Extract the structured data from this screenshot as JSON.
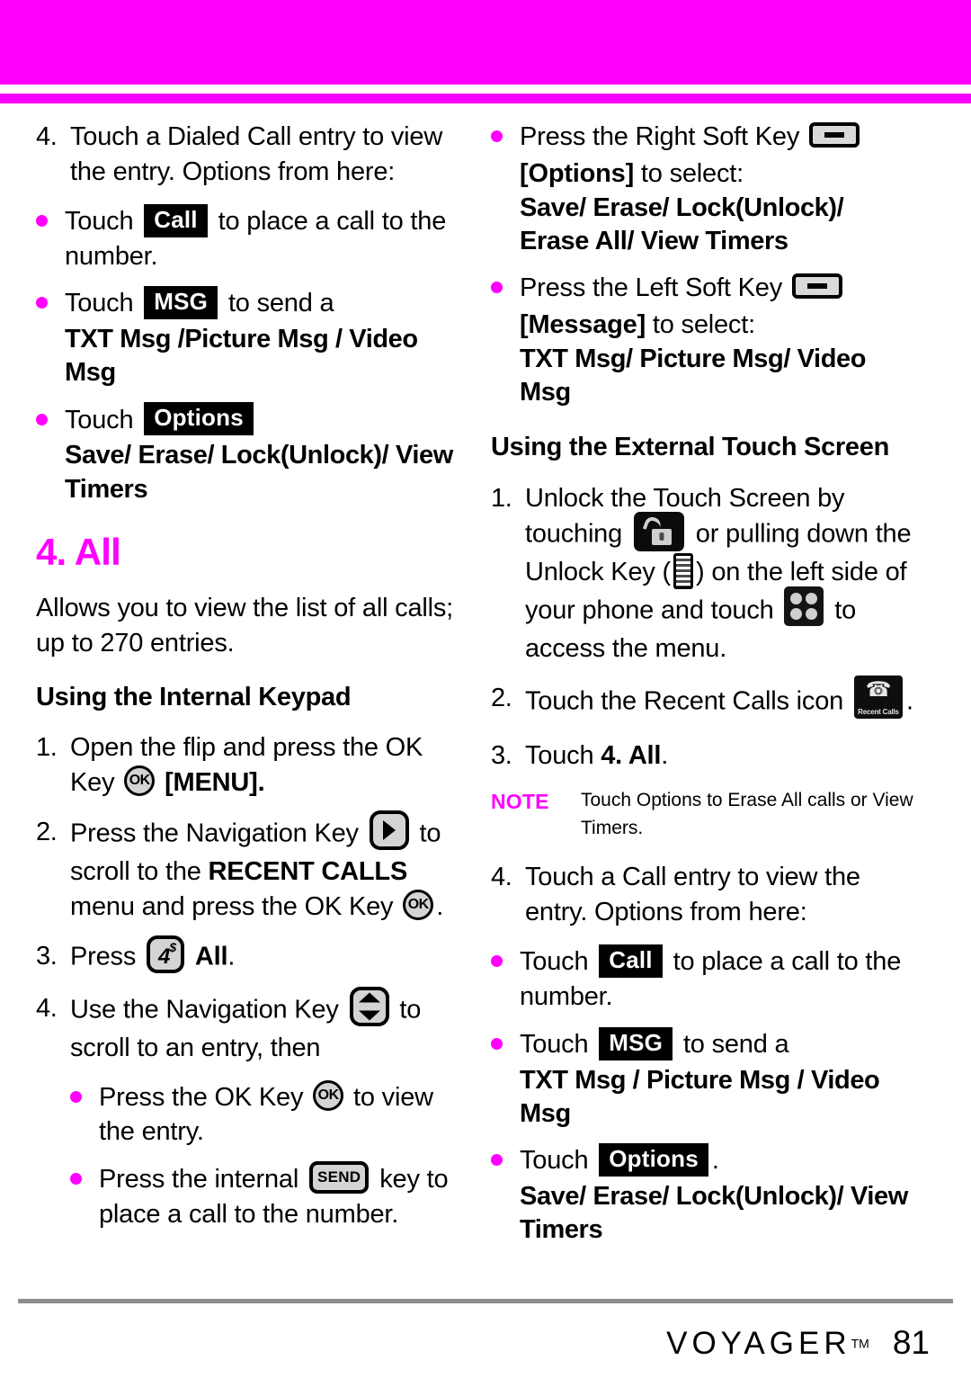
{
  "theme": {
    "accent": "#ff00ff",
    "text": "#000000",
    "background": "#ffffff",
    "rule": "#8c8c8c",
    "chip_bg": "#000000",
    "chip_fg": "#ffffff",
    "key_face": "#d4d4d4"
  },
  "banner": {
    "label": "top-magenta-banner"
  },
  "left_column": {
    "step4": {
      "number": "4.",
      "text": "Touch a Dialed Call entry to view the entry. Options from here:"
    },
    "bullet_call": {
      "pre": "Touch",
      "chip": "Call",
      "post": "to place a call to the number."
    },
    "bullet_msg": {
      "pre": "Touch",
      "chip": "MSG",
      "post": "to send a",
      "options": "TXT Msg /Picture Msg / Video Msg"
    },
    "bullet_options": {
      "pre": "Touch",
      "chip": "Options",
      "options": "Save/ Erase/ Lock(Unlock)/ View Timers"
    },
    "heading": "4. All",
    "intro": "Allows you to view the list of all calls; up to 270 entries.",
    "section_heading": "Using the Internal Keypad",
    "steps": [
      {
        "number": "1.",
        "pre": "Open the flip and press the OK Key",
        "key": "OK",
        "post": "[MENU]."
      },
      {
        "number": "2.",
        "pre": "Press the Navigation Key",
        "key": "nav-right",
        "mid": "to scroll to the",
        "bold": "RECENT CALLS",
        "post": "menu and press the OK Key",
        "key2": "OK",
        "tail": "."
      },
      {
        "number": "3.",
        "pre": "Press",
        "key": "4",
        "key_sub": "$",
        "bold": "All",
        "post": "."
      },
      {
        "number": "4.",
        "pre": "Use the Navigation Key",
        "key": "nav-up-down",
        "post": "to scroll to an entry, then"
      }
    ],
    "sub_bullets": [
      {
        "pre": "Press the OK Key",
        "key": "OK",
        "post": "to view the entry."
      },
      {
        "pre": "Press the internal",
        "key": "SEND",
        "post": "key to place a call to the number."
      }
    ]
  },
  "right_column": {
    "bullet_right_soft": {
      "pre": "Press the Right Soft Key",
      "key": "soft-key",
      "bracket": "[Options]",
      "mid": "to select:",
      "options": "Save/ Erase/ Lock(Unlock)/ Erase All/ View Timers"
    },
    "bullet_left_soft": {
      "pre": "Press the Left Soft Key",
      "key": "soft-key",
      "bracket": "[Message]",
      "mid": "to select:",
      "options": "TXT Msg/ Picture Msg/ Video Msg"
    },
    "section_heading": "Using the External Touch Screen",
    "step1": {
      "number": "1.",
      "p1": "Unlock the Touch Screen by touching",
      "icon1": "unlock-tile",
      "p2": "or pulling down the Unlock Key (",
      "icon2": "unlock-bar",
      "p3": ") on the left side of your phone and touch",
      "icon3": "menu-tile",
      "p4": "to access the menu."
    },
    "step2": {
      "number": "2.",
      "pre": "Touch the Recent Calls icon",
      "icon": "recent-calls-tile",
      "icon_caption": "Recent Calls",
      "post": "."
    },
    "step3": {
      "number": "3.",
      "pre": "Touch",
      "bold": "4. All",
      "post": "."
    },
    "note": {
      "tag": "NOTE",
      "text": "Touch Options to Erase All calls or View Timers."
    },
    "step4": {
      "number": "4.",
      "text": "Touch a Call entry to view the entry. Options from here:"
    },
    "bullet_call": {
      "pre": "Touch",
      "chip": "Call",
      "post": "to place a call to the number."
    },
    "bullet_msg": {
      "pre": "Touch",
      "chip": "MSG",
      "post": "to send a",
      "options": "TXT Msg / Picture Msg / Video Msg"
    },
    "bullet_options": {
      "pre": "Touch",
      "chip": "Options",
      "post": ".",
      "options": "Save/ Erase/ Lock(Unlock)/ View Timers"
    }
  },
  "footer": {
    "brand": "VOYAGER",
    "trademark": "TM",
    "page_number": "81"
  }
}
